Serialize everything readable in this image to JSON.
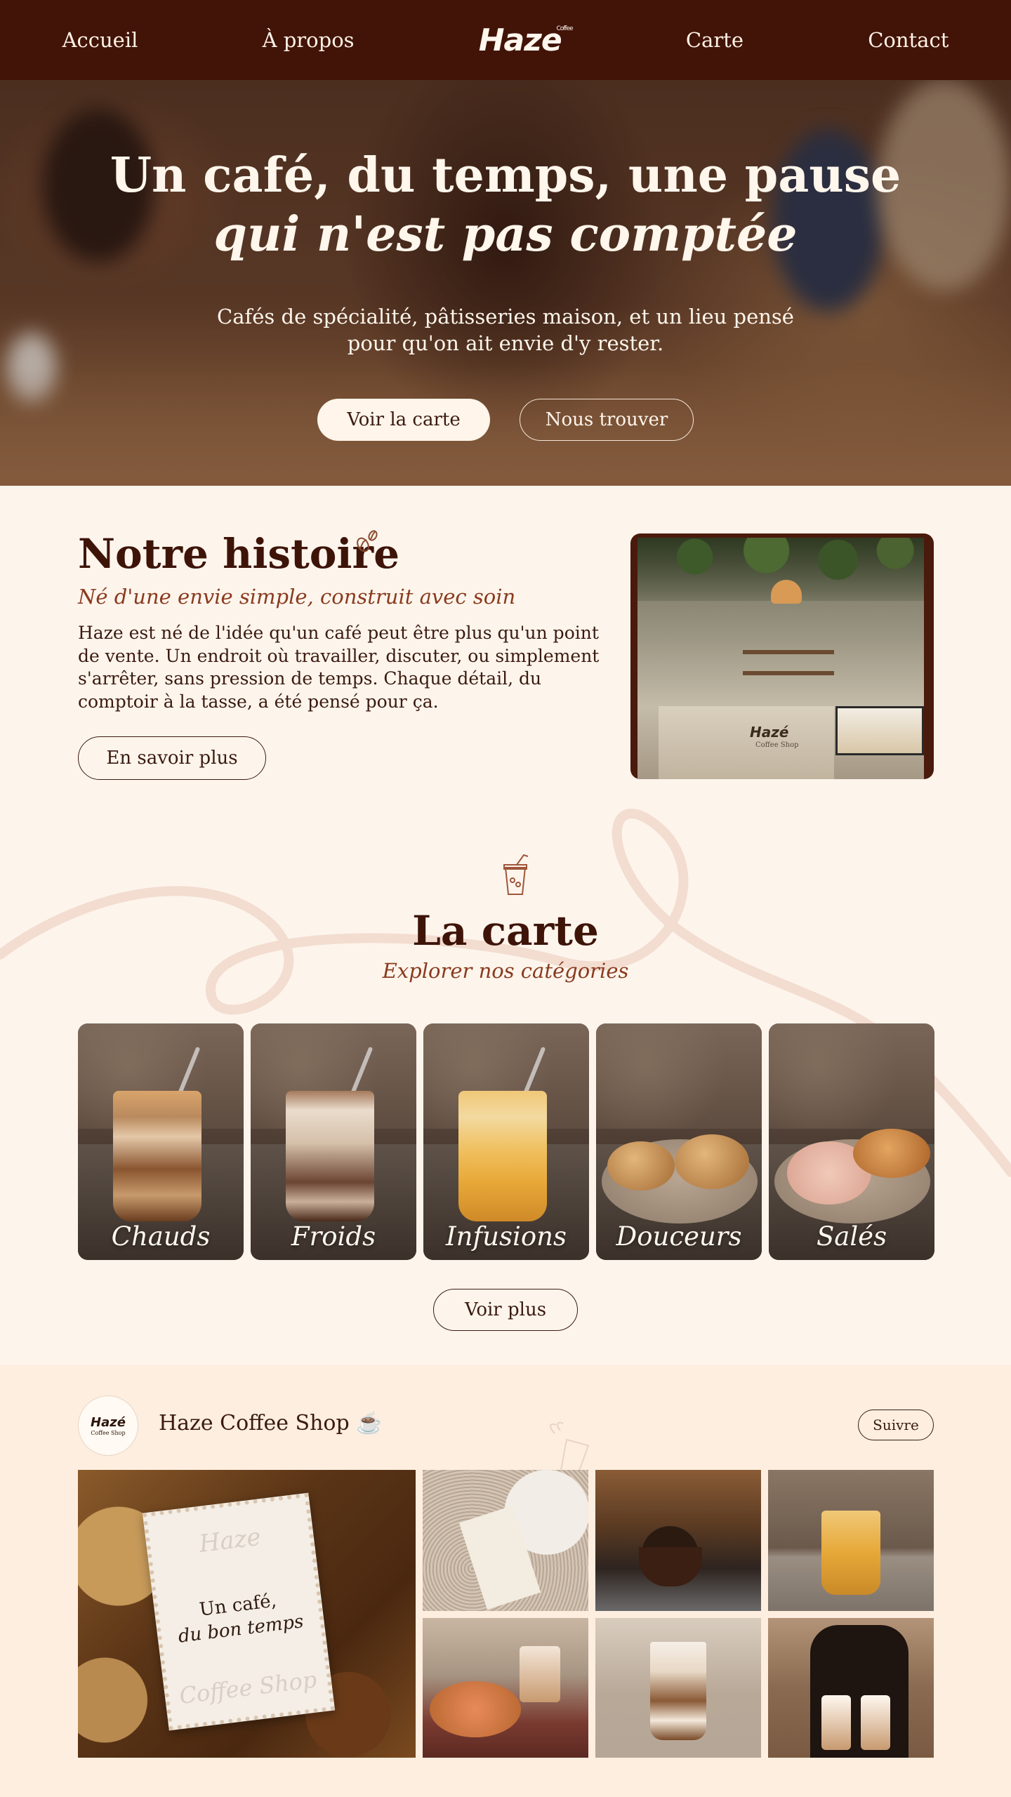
{
  "nav": {
    "items": [
      "Accueil",
      "À propos",
      "Carte",
      "Contact"
    ],
    "logo": "Haze",
    "logo_mark": "Coffee"
  },
  "hero": {
    "title_line1": "Un café, du temps, une pause",
    "title_line2": "qui n'est pas comptée",
    "subtitle": "Cafés de spécialité, pâtisseries maison, et un lieu pensé pour qu'on ait envie d'y rester.",
    "primary_button": "Voir la carte",
    "secondary_button": "Nous trouver"
  },
  "story": {
    "title": "Notre histoire",
    "subtitle": "Né d'une envie simple, construit avec soin",
    "text": "Haze est né de l'idée qu'un café peut être plus qu'un point de vente. Un endroit où travailler, discuter, ou simplement s'arrêter, sans pression de temps. Chaque détail, du comptoir à la tasse, a été pensé pour ça.",
    "button": "En savoir plus",
    "photo_sign": "Hazé",
    "photo_sign_sub": "Coffee Shop"
  },
  "menu": {
    "title": "La carte",
    "subtitle": "Explorer nos catégories",
    "categories": [
      {
        "label": "Chauds"
      },
      {
        "label": "Froids"
      },
      {
        "label": "Infusions"
      },
      {
        "label": "Douceurs"
      },
      {
        "label": "Salés"
      }
    ],
    "more_button": "Voir plus"
  },
  "instagram": {
    "avatar_logo": "Hazé",
    "avatar_sub": "Coffee Shop",
    "account_name": "Haze Coffee Shop ☕",
    "follow_button": "Suivre",
    "feature_stamp": {
      "top": "Haze",
      "line1": "Un café,",
      "line2": "du bon temps",
      "bottom": "Coffee Shop"
    }
  },
  "colors": {
    "nav_bg": "#421307",
    "page_bg": "#fdf5ec",
    "insta_bg": "#fdeee0",
    "heading": "#3e1408",
    "accent": "#8a3a1e"
  }
}
